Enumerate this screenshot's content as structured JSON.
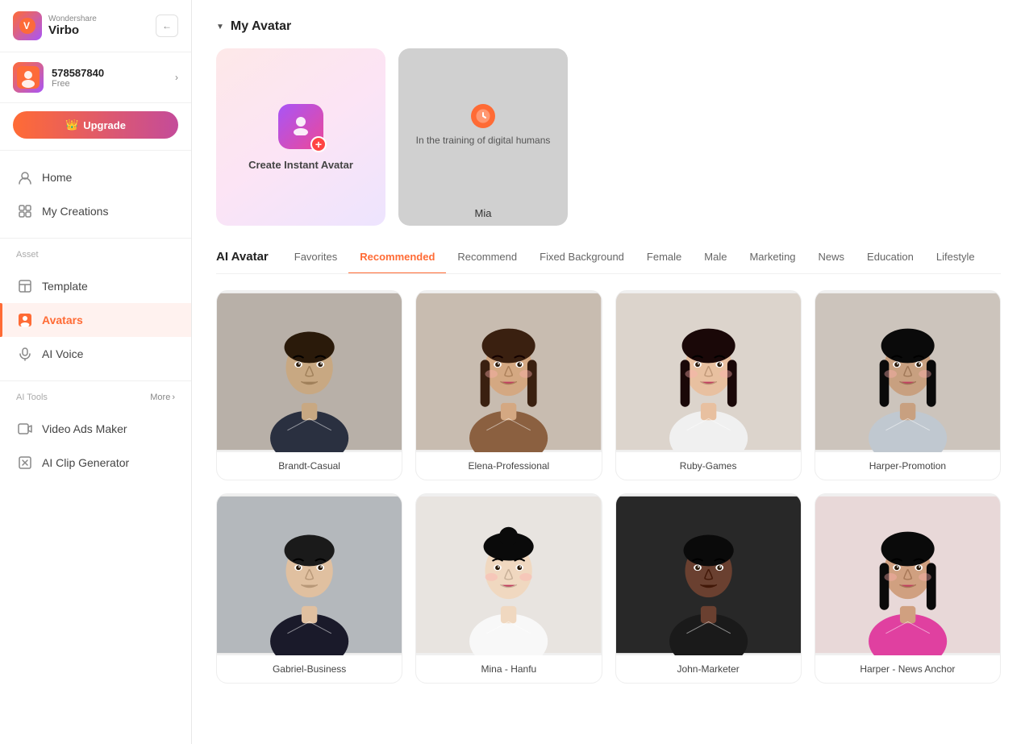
{
  "app": {
    "brand": "Wondershare",
    "name": "Virbo",
    "collapse_label": "←"
  },
  "user": {
    "id": "578587840",
    "plan": "Free",
    "upgrade_label": "Upgrade"
  },
  "sidebar": {
    "nav_items": [
      {
        "id": "home",
        "label": "Home",
        "icon": "👤",
        "active": false
      },
      {
        "id": "my-creations",
        "label": "My Creations",
        "icon": "🗂",
        "active": false
      }
    ],
    "asset_section": "Asset",
    "asset_items": [
      {
        "id": "template",
        "label": "Template",
        "icon": "⊞",
        "active": false
      },
      {
        "id": "avatars",
        "label": "Avatars",
        "icon": "👤",
        "active": true
      },
      {
        "id": "ai-voice",
        "label": "AI Voice",
        "icon": "🎙",
        "active": false
      }
    ],
    "tools_section": "AI Tools",
    "tools_more": "More",
    "tools_items": [
      {
        "id": "video-ads",
        "label": "Video Ads Maker",
        "icon": "▶",
        "active": false
      },
      {
        "id": "ai-clip",
        "label": "AI Clip Generator",
        "icon": "✂",
        "active": false
      }
    ]
  },
  "my_avatar": {
    "section_title": "My Avatar",
    "create_card": {
      "label": "Create Instant Avatar"
    },
    "training_card": {
      "status": "In the training of digital humans",
      "name": "Mia"
    }
  },
  "ai_avatar": {
    "section_title": "AI Avatar",
    "tabs": [
      {
        "id": "favorites",
        "label": "Favorites",
        "active": false
      },
      {
        "id": "recommended",
        "label": "Recommended",
        "active": true
      },
      {
        "id": "recommend",
        "label": "Recommend",
        "active": false
      },
      {
        "id": "fixed-bg",
        "label": "Fixed Background",
        "active": false
      },
      {
        "id": "female",
        "label": "Female",
        "active": false
      },
      {
        "id": "male",
        "label": "Male",
        "active": false
      },
      {
        "id": "marketing",
        "label": "Marketing",
        "active": false
      },
      {
        "id": "news",
        "label": "News",
        "active": false
      },
      {
        "id": "education",
        "label": "Education",
        "active": false
      },
      {
        "id": "lifestyle",
        "label": "Lifestyle",
        "active": false
      }
    ],
    "avatars": [
      {
        "id": "brandt",
        "label": "Brandt-Casual",
        "bg": "bg-brandt",
        "gender": "male",
        "skin": "#c8a882",
        "hair": "#2a1a0a",
        "shirt": "#2a3040"
      },
      {
        "id": "elena",
        "label": "Elena-Professional",
        "bg": "bg-elena",
        "gender": "female",
        "skin": "#d4a882",
        "hair": "#3a2010",
        "shirt": "#8b6040"
      },
      {
        "id": "ruby",
        "label": "Ruby-Games",
        "bg": "bg-ruby",
        "gender": "female",
        "skin": "#e8c0a0",
        "hair": "#1a0808",
        "shirt": "#f0f0f0"
      },
      {
        "id": "harper-p",
        "label": "Harper-Promotion",
        "bg": "bg-harper-p",
        "gender": "female",
        "skin": "#c8a080",
        "hair": "#0a0a0a",
        "shirt": "#c0c8d0"
      },
      {
        "id": "gabriel",
        "label": "Gabriel-Business",
        "bg": "bg-gabriel",
        "gender": "male",
        "skin": "#e0c0a0",
        "hair": "#1a1a1a",
        "shirt": "#1a1a2a"
      },
      {
        "id": "mina",
        "label": "Mina - Hanfu",
        "bg": "bg-mina",
        "gender": "female",
        "skin": "#f0d8c0",
        "hair": "#0a0a0a",
        "shirt": "#f8f8f8"
      },
      {
        "id": "john",
        "label": "John-Marketer",
        "bg": "bg-john",
        "gender": "male",
        "skin": "#6a4030",
        "hair": "#0a0a0a",
        "shirt": "#1a1a1a"
      },
      {
        "id": "harper-n",
        "label": "Harper - News Anchor",
        "bg": "bg-harper-n",
        "gender": "female",
        "skin": "#d0a080",
        "hair": "#0a0a0a",
        "shirt": "#e040a0"
      }
    ]
  }
}
